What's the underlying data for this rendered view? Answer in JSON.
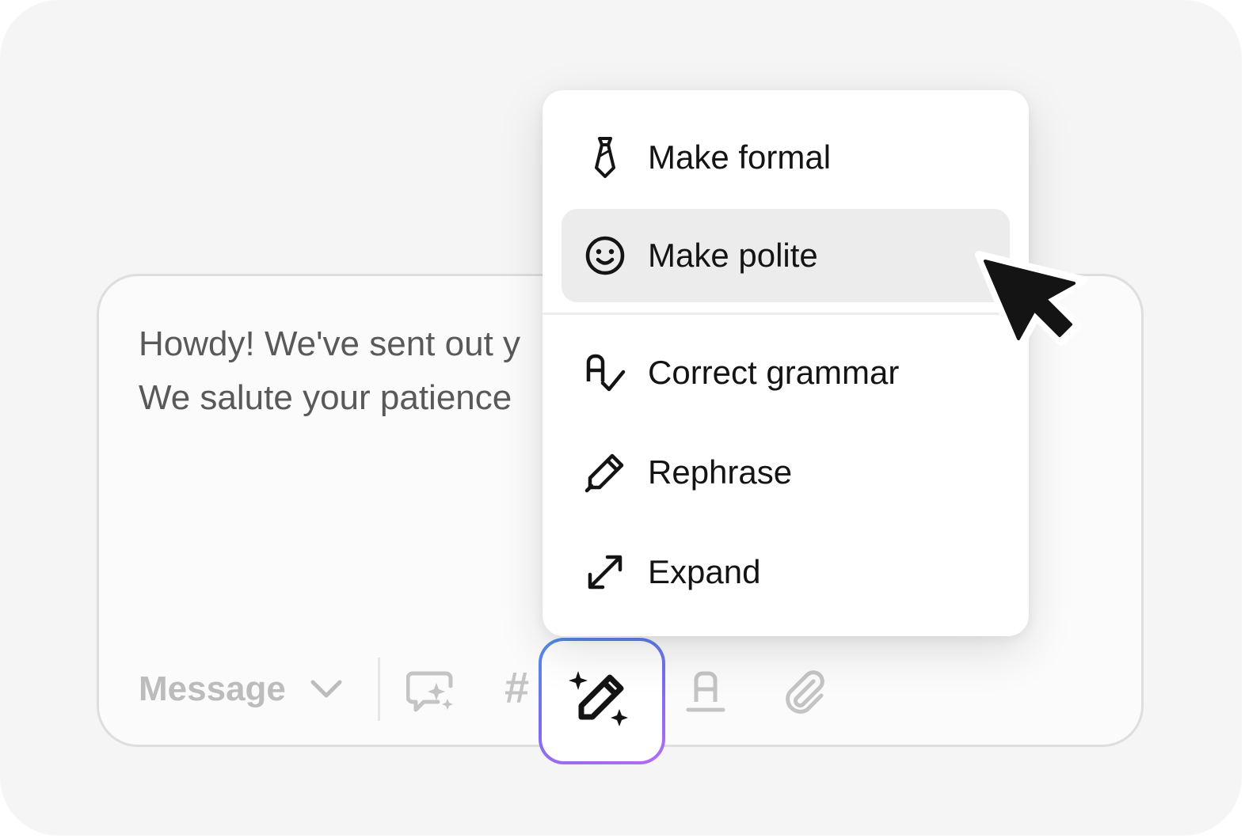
{
  "composer": {
    "message_lines": [
      "Howdy! We've sent out y",
      "We salute your patience"
    ],
    "mode_label": "Message"
  },
  "toolbar": {
    "icons": [
      "chat-sparkle-icon",
      "hash-icon",
      "ai-rewrite-icon",
      "text-format-icon",
      "paperclip-icon"
    ],
    "hash_glyph": "#"
  },
  "menu": {
    "items": [
      {
        "label": "Make formal",
        "icon": "tie-icon"
      },
      {
        "label": "Make polite",
        "icon": "smiley-icon",
        "highlighted": true
      },
      {
        "label": "Correct grammar",
        "icon": "grammar-check-icon"
      },
      {
        "label": "Rephrase",
        "icon": "pencil-icon"
      },
      {
        "label": "Expand",
        "icon": "expand-arrows-icon"
      }
    ]
  },
  "colors": {
    "highlight": "#ececec",
    "ai_gradient_start": "#4f8fe8",
    "ai_gradient_end": "#b36cf6",
    "text_primary": "#141414",
    "text_muted": "#bdbdbd"
  }
}
